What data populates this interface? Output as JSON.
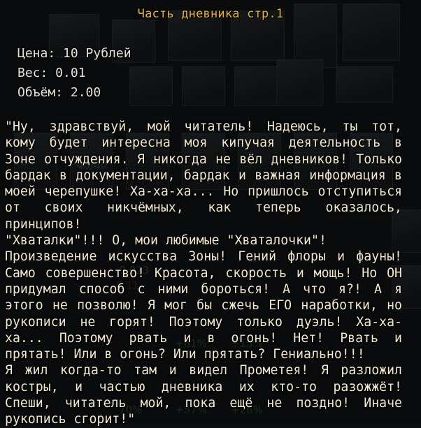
{
  "item": {
    "title": "Часть дневника стр.1",
    "price_label": "Цена: 10 Рублей",
    "weight_label": "Вес: 0.01",
    "volume_label": "Объём: 2.00"
  },
  "description": "\"Ну, здравствуй, мой читатель! Надеюсь, ты тот, кому будет интересна моя кипучая деятельность в Зоне отчуждения. Я никогда не вёл дневников! Только бардак в документации, бардак и важная информация в моей черепушке! Ха-ха-ха... Но пришлось отступиться от своих никчёмных, как теперь оказалось, принципов!\n\"Хваталки\"!!! О, мои любимые \"Хваталочки\"!\nПроизведение искусства Зоны! Гений флоры и фауны! Само совершенство! Красота, скорость и мощь! Но ОН придумал способ с ними бороться! А что я?! А я этого не позволю! Я мог бы сжечь ЕГО наработки, но рукописи не горят! Поэтому только дуэль! Ха-ха-ха... Поэтому рвать и в огонь! Нет! Рвать и прятать! Или в огонь? Или прятать? Гениально!!!\nЯ жил когда-то там и видел Прометея! Я разложил костры, и частью дневника их кто-то разожжёт! Спеши, читатель мой, пока ещё не поздно! Иначе рукопись сгорит!\"",
  "colors": {
    "title": "#e8b332",
    "stats": "#e7e3d6",
    "text": "#f2e9cc"
  }
}
